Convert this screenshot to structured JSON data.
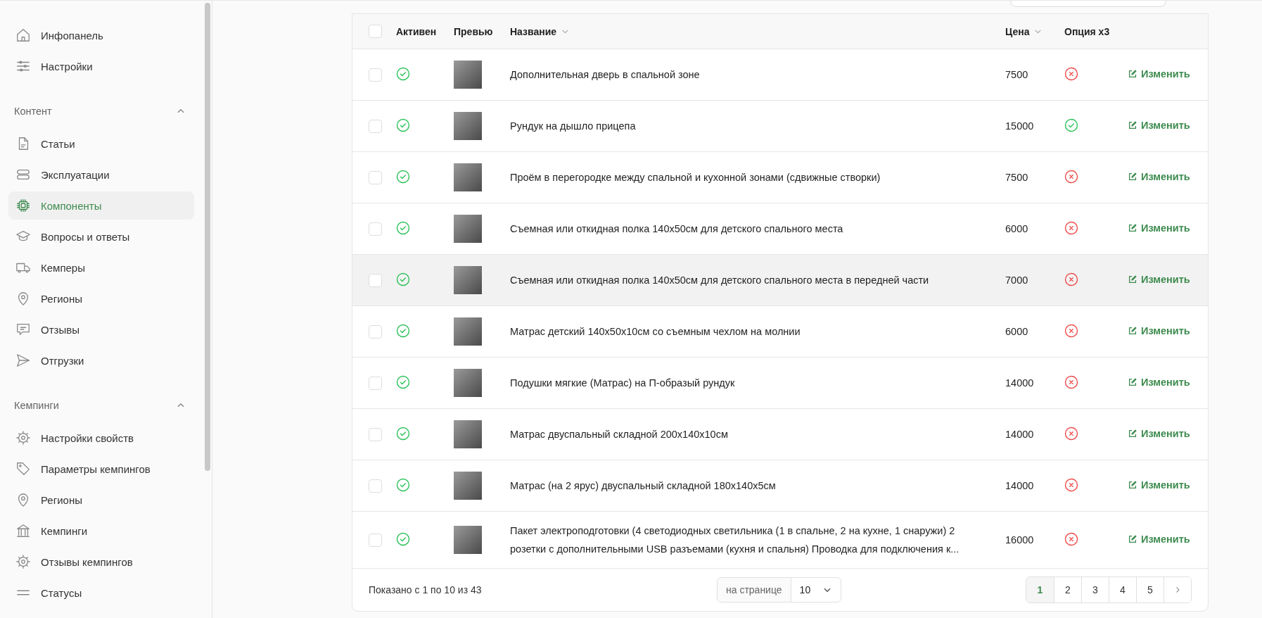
{
  "sidebar": {
    "top_items": [
      {
        "label": "Инфопанель",
        "selected": false
      },
      {
        "label": "Настройки",
        "selected": false
      }
    ],
    "groups": [
      {
        "title": "Контент",
        "expanded": true,
        "items": [
          {
            "label": "Статьи",
            "selected": false
          },
          {
            "label": "Эксплуатации",
            "selected": false
          },
          {
            "label": "Компоненты",
            "selected": true
          },
          {
            "label": "Вопросы и ответы",
            "selected": false
          },
          {
            "label": "Кемперы",
            "selected": false
          },
          {
            "label": "Регионы",
            "selected": false
          },
          {
            "label": "Отзывы",
            "selected": false
          },
          {
            "label": "Отгрузки",
            "selected": false
          }
        ]
      },
      {
        "title": "Кемпинги",
        "expanded": true,
        "items": [
          {
            "label": "Настройки свойств",
            "selected": false
          },
          {
            "label": "Параметры кемпингов",
            "selected": false
          },
          {
            "label": "Регионы",
            "selected": false
          },
          {
            "label": "Кемпинги",
            "selected": false
          },
          {
            "label": "Отзывы кемпингов",
            "selected": false
          },
          {
            "label": "Статусы",
            "selected": false
          }
        ]
      }
    ]
  },
  "table": {
    "select_all": {
      "checked": false
    },
    "columns": [
      {
        "label": "Активен",
        "sortable": false
      },
      {
        "label": "Превью",
        "sortable": false
      },
      {
        "label": "Название",
        "sortable": true
      },
      {
        "label": "Цена",
        "sortable": true
      },
      {
        "label": "Опция x3",
        "sortable": false
      }
    ],
    "rows": [
      {
        "checked": false,
        "active": true,
        "name": "Дополнительная дверь в спальной зоне",
        "price": "7500",
        "option_x3": false,
        "hovered": false,
        "action": "Изменить"
      },
      {
        "checked": false,
        "active": true,
        "name": "Рундук на дышло прицепа",
        "price": "15000",
        "option_x3": true,
        "hovered": false,
        "action": "Изменить"
      },
      {
        "checked": false,
        "active": true,
        "name": "Проём в перегородке между спальной и кухонной зонами (сдвижные створки)",
        "price": "7500",
        "option_x3": false,
        "hovered": false,
        "action": "Изменить"
      },
      {
        "checked": false,
        "active": true,
        "name": "Съемная или откидная полка 140х50см для детского спального места",
        "price": "6000",
        "option_x3": false,
        "hovered": false,
        "action": "Изменить"
      },
      {
        "checked": false,
        "active": true,
        "name": "Съемная или откидная полка 140х50см для детского спального места в передней части",
        "price": "7000",
        "option_x3": false,
        "hovered": true,
        "action": "Изменить"
      },
      {
        "checked": false,
        "active": true,
        "name": "Матрас детский 140х50х10см со съемным чехлом на молнии",
        "price": "6000",
        "option_x3": false,
        "hovered": false,
        "action": "Изменить"
      },
      {
        "checked": false,
        "active": true,
        "name": "Подушки мягкие (Матрас) на П-образый рундук",
        "price": "14000",
        "option_x3": false,
        "hovered": false,
        "action": "Изменить"
      },
      {
        "checked": false,
        "active": true,
        "name": "Матрас двуспальный складной 200х140х10см",
        "price": "14000",
        "option_x3": false,
        "hovered": false,
        "action": "Изменить"
      },
      {
        "checked": false,
        "active": true,
        "name": "Матрас (на 2 ярус) двуспальный складной 180х140х5см",
        "price": "14000",
        "option_x3": false,
        "hovered": false,
        "action": "Изменить"
      },
      {
        "checked": false,
        "active": true,
        "name": "Пакет электроподготовки (4 светодиодных светильника (1 в спальне, 2 на кухне, 1 снаружи) 2 розетки с дополнительными USB разъемами (кухня и спальня) Проводка для подключения к...",
        "price": "16000",
        "option_x3": false,
        "hovered": false,
        "action": "Изменить"
      }
    ]
  },
  "footer": {
    "summary": "Показано с 1 по 10 из 43",
    "per_page_label": "на странице",
    "per_page_value": "10",
    "pages": [
      {
        "label": "1",
        "selected": true
      },
      {
        "label": "2",
        "selected": false
      },
      {
        "label": "3",
        "selected": false
      },
      {
        "label": "4",
        "selected": false
      },
      {
        "label": "5",
        "selected": false
      }
    ]
  }
}
